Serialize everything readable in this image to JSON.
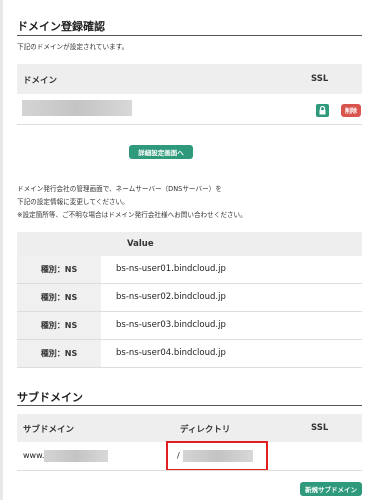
{
  "domain_section": {
    "title": "ドメイン登録確認",
    "description": "下記のドメインが設定されています。",
    "col_domain": "ドメイン",
    "col_ssl": "SSL",
    "delete_label": "削除",
    "detail_button": "詳細設定画面へ"
  },
  "instructions": {
    "line1": "ドメイン発行会社の管理画面で、ネームサーバー（DNSサーバー）を",
    "line2": "下記の設定情報に変更してください。",
    "line3": "※設定箇所等、ご不明な場合はドメイン発行会社様へお問い合わせください。"
  },
  "ns_table": {
    "header_value": "Value",
    "rows": [
      {
        "label": "種別：NS",
        "value": "bs-ns-user01.bindcloud.jp"
      },
      {
        "label": "種別：NS",
        "value": "bs-ns-user02.bindcloud.jp"
      },
      {
        "label": "種別：NS",
        "value": "bs-ns-user03.bindcloud.jp"
      },
      {
        "label": "種別：NS",
        "value": "bs-ns-user04.bindcloud.jp"
      }
    ]
  },
  "subdomain_section": {
    "title": "サブドメイン",
    "col_subdomain": "サブドメイン",
    "col_directory": "ディレクトリ",
    "col_ssl": "SSL",
    "row_subdomain_prefix": "www.",
    "row_directory_prefix": "/",
    "new_button": "新規サブドメイン"
  },
  "colors": {
    "accent": "#2e9a7b",
    "danger": "#d9534f",
    "highlight": "#e02020"
  }
}
